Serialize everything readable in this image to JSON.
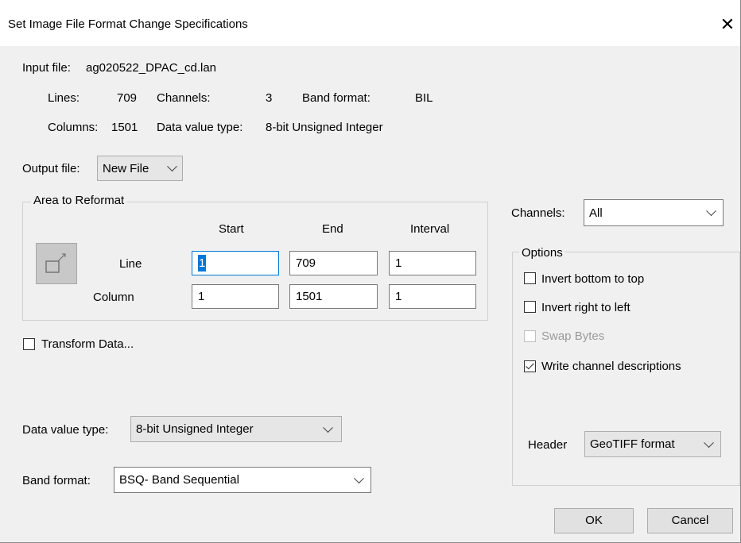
{
  "window": {
    "title": "Set Image File Format Change Specifications"
  },
  "input_file": {
    "label": "Input file:",
    "name": "ag020522_DPAC_cd.lan"
  },
  "info": {
    "lines_label": "Lines:",
    "lines_value": "709",
    "channels_label": "Channels:",
    "channels_value": "3",
    "band_format_label": "Band format:",
    "band_format_value": "BIL",
    "columns_label": "Columns:",
    "columns_value": "1501",
    "data_type_label": "Data value type:",
    "data_type_value": "8-bit Unsigned Integer"
  },
  "output_file": {
    "label": "Output file:",
    "value": "New File"
  },
  "area": {
    "title": "Area to Reformat",
    "col_start": "Start",
    "col_end": "End",
    "col_interval": "Interval",
    "line_label": "Line",
    "line_start": "1",
    "line_end": "709",
    "line_interval": "1",
    "column_label": "Column",
    "column_start": "1",
    "column_end": "1501",
    "column_interval": "1"
  },
  "transform": {
    "label": "Transform Data..."
  },
  "data_value_type": {
    "label": "Data value type:",
    "value": "8-bit Unsigned Integer"
  },
  "band_format": {
    "label": "Band format:",
    "value": "BSQ- Band Sequential"
  },
  "channels_select": {
    "label": "Channels:",
    "value": "All"
  },
  "options": {
    "title": "Options",
    "invert_bottom": "Invert bottom to top",
    "invert_right": "Invert right to left",
    "swap_bytes": "Swap Bytes",
    "write_channel": "Write channel descriptions",
    "header_label": "Header",
    "header_value": "GeoTIFF format"
  },
  "buttons": {
    "ok": "OK",
    "cancel": "Cancel"
  }
}
